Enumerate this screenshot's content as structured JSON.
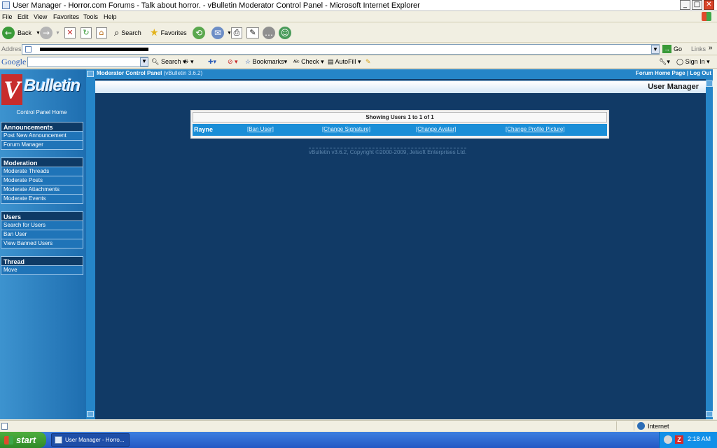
{
  "window": {
    "title": "User Manager - Horror.com Forums - Talk about horror. - vBulletin Moderator Control Panel - Microsoft Internet Explorer",
    "minimize_glyph": "_",
    "maximize_glyph": "□",
    "close_glyph": "✕"
  },
  "menu": [
    "File",
    "Edit",
    "View",
    "Favorites",
    "Tools",
    "Help"
  ],
  "toolbar": {
    "back": "Back",
    "search": "Search",
    "favorites": "Favorites"
  },
  "address": {
    "label": "Address",
    "go": "Go",
    "links": "Links"
  },
  "google_toolbar": {
    "logo": "Google",
    "search": "Search",
    "bookmarks": "Bookmarks",
    "check": "Check",
    "autofill": "AutoFill",
    "sign_in": "Sign In"
  },
  "sidebar": {
    "logo_text": "Bulletin",
    "home_link": "Control Panel Home",
    "groups": [
      {
        "title": "Announcements",
        "items": [
          "Post New Announcement",
          "Forum Manager"
        ]
      },
      {
        "title": "Moderation",
        "items": [
          "Moderate Threads",
          "Moderate Posts",
          "Moderate Attachments",
          "Moderate Events"
        ]
      },
      {
        "title": "Users",
        "items": [
          "Search for Users",
          "Ban User",
          "View Banned Users"
        ]
      },
      {
        "title": "Thread",
        "items": [
          "Move"
        ]
      }
    ]
  },
  "header": {
    "cp_title": "Moderator Control Panel",
    "cp_version": "(vBulletin 3.6.2)",
    "forum_home": "Forum Home Page",
    "separator": "|",
    "log_out": "Log Out",
    "section_title": "User Manager"
  },
  "users_table": {
    "heading": "Showing Users 1 to 1 of 1",
    "rows": [
      {
        "name": "Rayne",
        "ban": "[Ban User]",
        "signature": "[Change Signature]",
        "avatar": "[Change Avatar]",
        "profile_picture": "[Change Profile Picture]"
      }
    ]
  },
  "copyright": "vBulletin v3.6.2, Copyright ©2000-2009, Jelsoft Enterprises Ltd.",
  "status": {
    "zone": "Internet"
  },
  "taskbar": {
    "start": "start",
    "task": "User Manager - Horro...",
    "clock": "2:18 AM"
  },
  "colors": {
    "main_bg": "#113a66",
    "nav_bg": "#1e6eb0",
    "accent": "#2585c8",
    "row_bg": "#1a8ed7"
  }
}
